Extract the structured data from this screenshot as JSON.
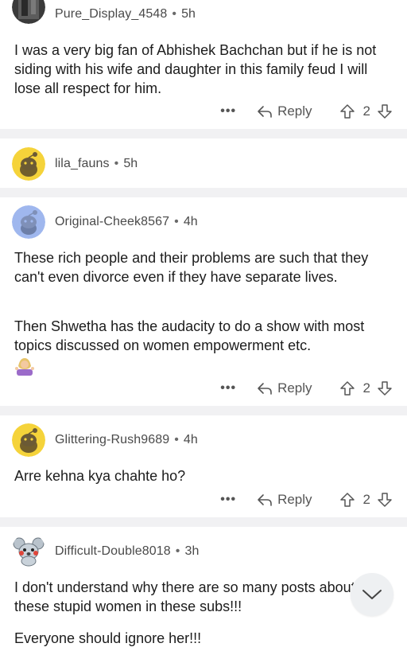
{
  "colors": {
    "separator": "#f1f1f3",
    "text": "#1c1c1c",
    "muted": "#555555"
  },
  "comments": [
    {
      "username": "Pure_Display_4548",
      "age": "5h",
      "avatar": "dark-avatar-icon",
      "text": "I was a very big fan of Abhishek Bachchan but if he is not siding with his wife and daughter in this family feud I will lose all respect for him.",
      "reply_label": "Reply",
      "votes": "2"
    },
    {
      "username": "lila_fauns",
      "age": "5h",
      "avatar": "yellow-snoo-avatar-icon",
      "collapsed": true
    },
    {
      "username": "Original-Cheek8567",
      "age": "4h",
      "avatar": "blue-snoo-avatar-icon",
      "paragraph1": "These rich people and their problems are such that they can't even divorce even if they have separate lives.",
      "paragraph2": "Then Shwetha has the audacity to do a show with most topics discussed on women empowerment etc.",
      "emoji": "woman-shrugging-emoji",
      "reply_label": "Reply",
      "votes": "2"
    },
    {
      "username": "Glittering-Rush9689",
      "age": "4h",
      "avatar": "yellow-snoo-avatar-icon",
      "text": "Arre kehna kya chahte ho?",
      "reply_label": "Reply",
      "votes": "2"
    },
    {
      "username": "Difficult-Double8018",
      "age": "3h",
      "avatar": "koala-snoo-avatar-icon",
      "paragraph1": "I don't understand why there are so many posts about these stupid women in these subs!!!",
      "paragraph2": "Everyone should ignore her!!!"
    }
  ],
  "more_label": "•••",
  "scroll_button_icon": "chevron-down-icon"
}
